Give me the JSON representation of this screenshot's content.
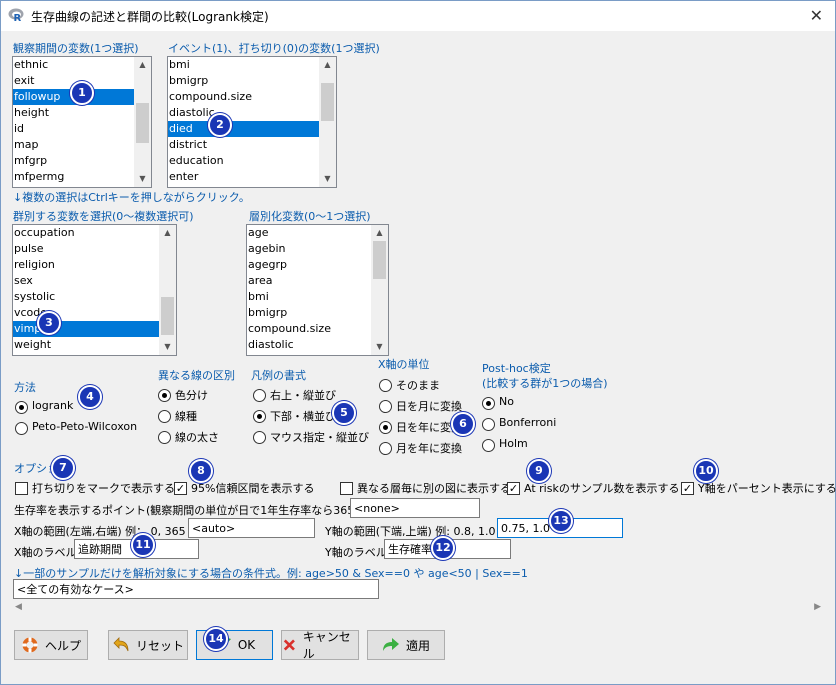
{
  "window": {
    "title": "生存曲線の記述と群間の比較(Logrank検定)",
    "close": "✕"
  },
  "observation": {
    "label": "観察期間の変数(1つ選択)",
    "items": [
      "ethnic",
      "exit",
      "followup",
      "height",
      "id",
      "map",
      "mfgrp",
      "mfpermg"
    ],
    "selected": "followup"
  },
  "event": {
    "label": "イベント(1)、打ち切り(0)の変数(1つ選択)",
    "items": [
      "bmi",
      "bmigrp",
      "compound.size",
      "diastolic",
      "died",
      "district",
      "education",
      "enter"
    ],
    "selected": "died"
  },
  "hint_multi": "↓複数の選択はCtrlキーを押しながらクリック。",
  "group": {
    "label": "群別する変数を選択(0〜複数選択可)",
    "items": [
      "occupation",
      "pulse",
      "religion",
      "sex",
      "systolic",
      "vcode",
      "vimp",
      "weight"
    ],
    "selected": "vimp"
  },
  "strata": {
    "label": "層別化変数(0〜1つ選択)",
    "items": [
      "age",
      "agebin",
      "agegrp",
      "area",
      "bmi",
      "bmigrp",
      "compound.size",
      "diastolic"
    ]
  },
  "method": {
    "label": "方法",
    "options": [
      "logrank",
      "Peto-Peto-Wilcoxon"
    ],
    "selected": 0
  },
  "line_diff": {
    "label": "異なる線の区別",
    "options": [
      "色分け",
      "線種",
      "線の太さ"
    ],
    "selected": 0
  },
  "legend": {
    "label": "凡例の書式",
    "options": [
      "右上・縦並び",
      "下部・横並び",
      "マウス指定・縦並び"
    ],
    "selected": 1
  },
  "xunit": {
    "label": "X軸の単位",
    "options": [
      "そのまま",
      "日を月に変換",
      "日を年に変換",
      "月を年に変換"
    ],
    "selected": 2
  },
  "posthoc": {
    "label1": "Post-hoc検定",
    "label2": "(比較する群が1つの場合)",
    "options": [
      "No",
      "Bonferroni",
      "Holm"
    ],
    "selected": 0
  },
  "options": {
    "label": "オプション",
    "checks": [
      {
        "label": "打ち切りをマークで表示する",
        "checked": false
      },
      {
        "label": "95%信頼区間を表示する",
        "checked": true
      },
      {
        "label": "異なる層毎に別の図に表示する",
        "checked": false
      },
      {
        "label": "At riskのサンプル数を表示する",
        "checked": true
      },
      {
        "label": "Y軸をパーセント表示にする",
        "checked": true
      }
    ]
  },
  "survival_point": {
    "label": "生存率を表示するポイント(観察期間の単位が日で1年生存率なら365)",
    "value": "<none>"
  },
  "xrange": {
    "label": "X軸の範囲(左端,右端) 例： 0, 365",
    "value": "<auto>"
  },
  "yrange": {
    "label": "Y軸の範囲(下端,上端) 例: 0.8, 1.0",
    "value": "0.75, 1.0"
  },
  "xlabel": {
    "label": "X軸のラベル",
    "value": "追跡期間"
  },
  "ylabel": {
    "label": "Y軸のラベル",
    "value": "生存確率"
  },
  "subset": {
    "label": "↓一部のサンプルだけを解析対象にする場合の条件式。例: age>50 & Sex==0 や age<50 | Sex==1",
    "value": "<全ての有効なケース>"
  },
  "buttons": {
    "help": "ヘルプ",
    "reset": "リセット",
    "ok": "OK",
    "cancel": "キャンセル",
    "apply": "適用"
  },
  "badges": [
    "1",
    "2",
    "3",
    "4",
    "5",
    "6",
    "7",
    "8",
    "9",
    "10",
    "11",
    "12",
    "13",
    "14"
  ],
  "colors": {
    "accent": "#0078d7",
    "badge": "#1a36b5",
    "label_blue": "#0b5cad"
  }
}
